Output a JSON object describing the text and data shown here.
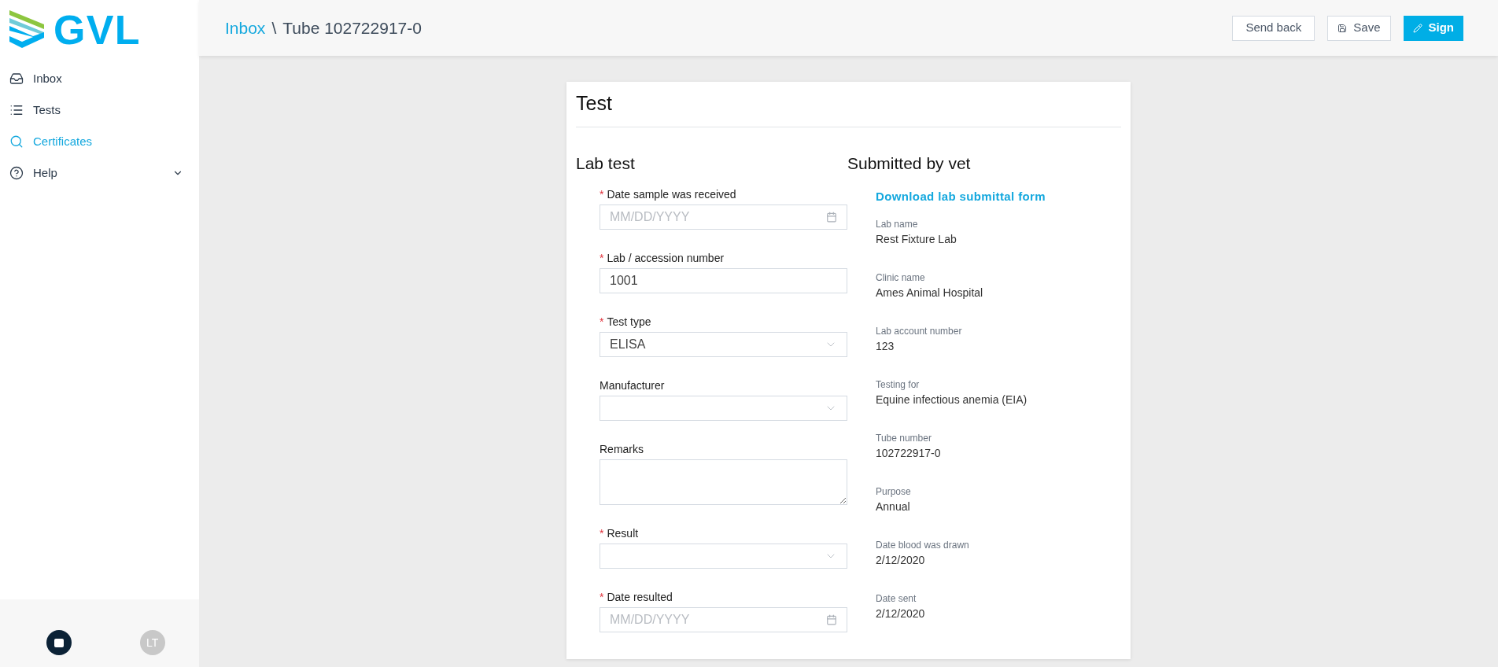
{
  "logo": {
    "text": "GVL"
  },
  "sidebar": {
    "items": [
      {
        "label": "Inbox",
        "selected": false
      },
      {
        "label": "Tests",
        "selected": false
      },
      {
        "label": "Certificates",
        "selected": true
      },
      {
        "label": "Help",
        "selected": false,
        "expanded": false
      }
    ],
    "footer": {
      "avatar_initials": "LT"
    }
  },
  "header": {
    "breadcrumb": [
      {
        "label": "Inbox",
        "link": true
      },
      {
        "label": "\\",
        "link": false
      },
      {
        "label": "Tube 102722917-0",
        "link": false
      }
    ],
    "buttons": [
      {
        "label": "Send back",
        "kind": "plain"
      },
      {
        "label": "Save",
        "kind": "save"
      },
      {
        "label": "Sign",
        "kind": "primary"
      }
    ]
  },
  "card": {
    "title": "Test",
    "lab_test": {
      "heading": "Lab test",
      "fields": [
        {
          "required_mark": "*",
          "label": "Date sample was received",
          "kind": "date",
          "placeholder": "MM/DD/YYYY"
        },
        {
          "required_mark": "*",
          "label": "Lab / accession number",
          "kind": "text",
          "value": "1001"
        },
        {
          "required_mark": "*",
          "label": "Test type",
          "kind": "select",
          "value": "ELISA"
        },
        {
          "label": "Manufacturer",
          "kind": "select"
        },
        {
          "label": "Remarks",
          "kind": "textarea"
        },
        {
          "required_mark": "*",
          "label": "Result",
          "kind": "select"
        },
        {
          "required_mark": "*",
          "label": "Date resulted",
          "kind": "date",
          "placeholder": "MM/DD/YYYY"
        }
      ]
    },
    "submitted_by_vet": {
      "heading": "Submitted by vet",
      "link": "Download lab submittal form",
      "details": [
        {
          "label": "Lab name",
          "value": "Rest Fixture Lab"
        },
        {
          "label": "Clinic name",
          "value": "Ames Animal Hospital"
        },
        {
          "label": "Lab account number",
          "value": "123"
        },
        {
          "label": "Testing for",
          "value": "Equine infectious anemia (EIA)"
        },
        {
          "label": "Tube number",
          "value": "102722917-0"
        },
        {
          "label": "Purpose",
          "value": "Annual"
        },
        {
          "label": "Date blood was drawn",
          "value": "2/12/2020"
        },
        {
          "label": "Date sent",
          "value": "2/12/2020"
        }
      ]
    }
  }
}
